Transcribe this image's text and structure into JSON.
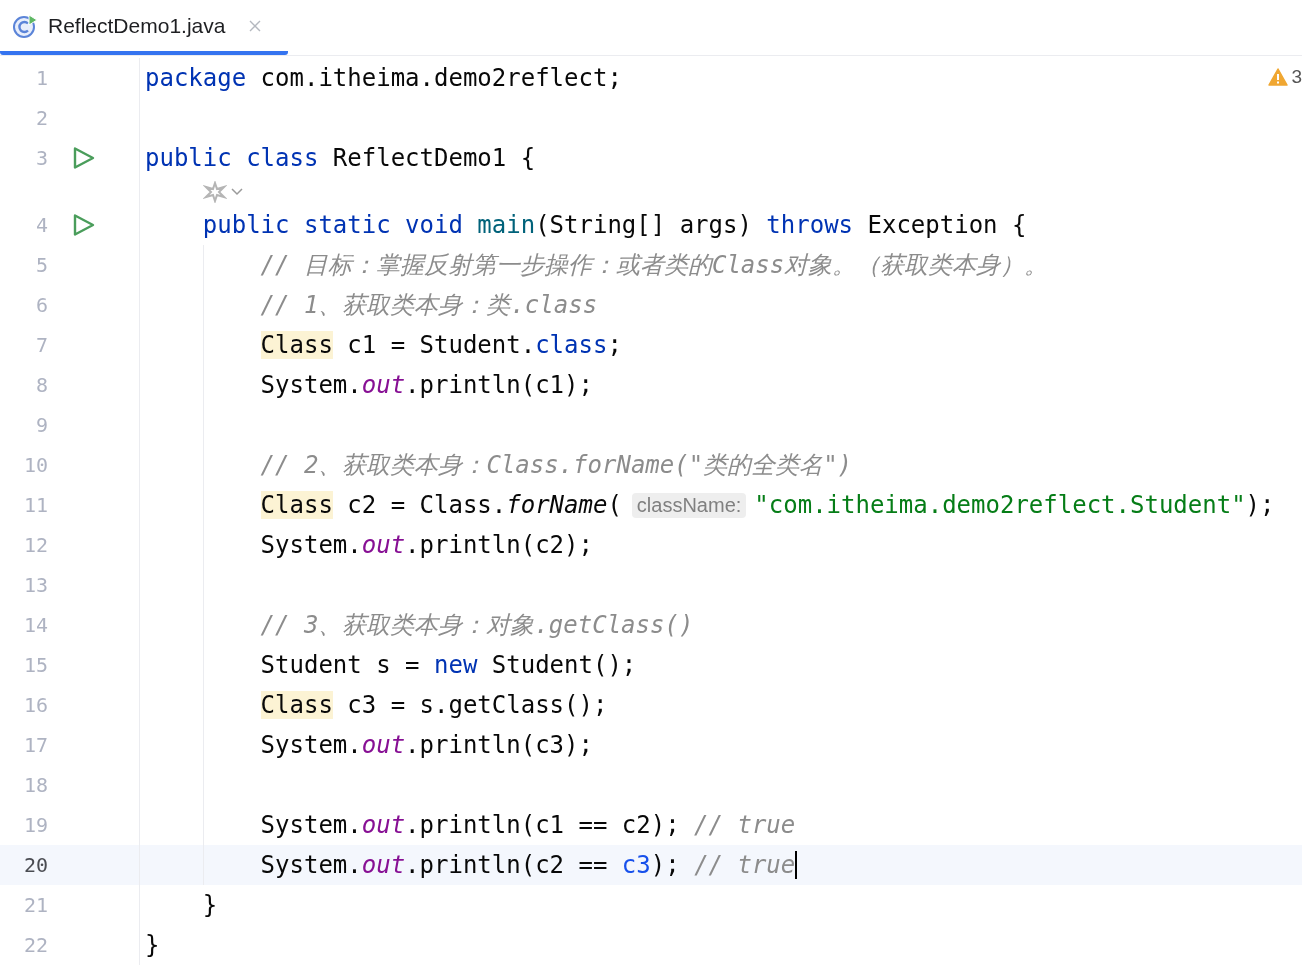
{
  "tabs": [
    {
      "label": "ReflectDemo1.java",
      "selected": true
    }
  ],
  "inspections": {
    "warnings": "3"
  },
  "lines": [
    {
      "kind": "code",
      "number": "1",
      "run": false,
      "current": false,
      "tokens": [
        {
          "kind": "keyword",
          "text": "package"
        },
        {
          "kind": "plain",
          "text": " com.itheima.demo2reflect;"
        }
      ]
    },
    {
      "kind": "code",
      "number": "2",
      "run": false,
      "current": false
    },
    {
      "kind": "code",
      "number": "3",
      "run": true,
      "current": false,
      "tokens": [
        {
          "kind": "keyword",
          "text": "public"
        },
        {
          "kind": "keyword",
          "text": " class"
        },
        {
          "kind": "plain",
          "text": " ReflectDemo1 {"
        }
      ],
      "children": [
        {
          "kind": "inlay"
        },
        {
          "kind": "code",
          "number": "4",
          "run": true,
          "current": false,
          "tokens": [
            {
              "kind": "keyword",
              "text": "public"
            },
            {
              "kind": "keyword",
              "text": " static"
            },
            {
              "kind": "keyword",
              "text": " void"
            },
            {
              "kind": "decl",
              "text": " main"
            },
            {
              "kind": "plain",
              "text": "(String[] args) "
            },
            {
              "kind": "keyword",
              "text": "throws"
            },
            {
              "kind": "plain",
              "text": " Exception {"
            }
          ],
          "children": [
            {
              "kind": "code",
              "number": "5",
              "run": false,
              "current": false,
              "tokens": [
                {
                  "kind": "comment",
                  "text": "// 目标：掌握反射第一步操作：或者类的Class对象。（获取类本身）。"
                }
              ]
            },
            {
              "kind": "code",
              "number": "6",
              "run": false,
              "current": false,
              "tokens": [
                {
                  "kind": "comment",
                  "text": "// 1、获取类本身：类.class"
                }
              ]
            },
            {
              "kind": "code",
              "number": "7",
              "run": false,
              "current": false,
              "tokens": [
                {
                  "kind": "type",
                  "text": "Class"
                },
                {
                  "kind": "plain",
                  "text": " c1 = Student."
                },
                {
                  "kind": "keyword",
                  "text": "class"
                },
                {
                  "kind": "plain",
                  "text": ";"
                }
              ]
            },
            {
              "kind": "code",
              "number": "8",
              "run": false,
              "current": false,
              "tokens": [
                {
                  "kind": "plain",
                  "text": "System."
                },
                {
                  "kind": "static",
                  "text": "out"
                },
                {
                  "kind": "plain",
                  "text": ".println(c1);"
                }
              ]
            },
            {
              "kind": "code",
              "number": "9",
              "run": false,
              "current": false
            },
            {
              "kind": "code",
              "number": "10",
              "run": false,
              "current": false,
              "tokens": [
                {
                  "kind": "comment",
                  "text": "// 2、获取类本身：Class.forName(\"类的全类名\")"
                }
              ]
            },
            {
              "kind": "code",
              "number": "11",
              "run": false,
              "current": false,
              "tokens": [
                {
                  "kind": "type",
                  "text": "Class"
                },
                {
                  "kind": "plain",
                  "text": " c2 = Class."
                },
                {
                  "kind": "method",
                  "text": "forName"
                },
                {
                  "kind": "plain",
                  "text": "("
                },
                {
                  "kind": "hint",
                  "text": "className:"
                },
                {
                  "kind": "string",
                  "text": "\"com.itheima.demo2reflect.Student\""
                },
                {
                  "kind": "plain",
                  "text": ");"
                }
              ]
            },
            {
              "kind": "code",
              "number": "12",
              "run": false,
              "current": false,
              "tokens": [
                {
                  "kind": "plain",
                  "text": "System."
                },
                {
                  "kind": "static",
                  "text": "out"
                },
                {
                  "kind": "plain",
                  "text": ".println(c2);"
                }
              ]
            },
            {
              "kind": "code",
              "number": "13",
              "run": false,
              "current": false
            },
            {
              "kind": "code",
              "number": "14",
              "run": false,
              "current": false,
              "tokens": [
                {
                  "kind": "comment",
                  "text": "// 3、获取类本身：对象.getClass()"
                }
              ]
            },
            {
              "kind": "code",
              "number": "15",
              "run": false,
              "current": false,
              "tokens": [
                {
                  "kind": "plain",
                  "text": "Student s = "
                },
                {
                  "kind": "keyword",
                  "text": "new"
                },
                {
                  "kind": "plain",
                  "text": " Student();"
                }
              ]
            },
            {
              "kind": "code",
              "number": "16",
              "run": false,
              "current": false,
              "tokens": [
                {
                  "kind": "type",
                  "text": "Class"
                },
                {
                  "kind": "plain",
                  "text": " c3 = s.getClass();"
                }
              ]
            },
            {
              "kind": "code",
              "number": "17",
              "run": false,
              "current": false,
              "tokens": [
                {
                  "kind": "plain",
                  "text": "System."
                },
                {
                  "kind": "static",
                  "text": "out"
                },
                {
                  "kind": "plain",
                  "text": ".println(c3);"
                }
              ]
            },
            {
              "kind": "code",
              "number": "18",
              "run": false,
              "current": false
            },
            {
              "kind": "code",
              "number": "19",
              "run": false,
              "current": false,
              "tokens": [
                {
                  "kind": "plain",
                  "text": "System."
                },
                {
                  "kind": "static",
                  "text": "out"
                },
                {
                  "kind": "plain",
                  "text": ".println(c1 == c2); "
                },
                {
                  "kind": "comment",
                  "text": "// true"
                }
              ]
            },
            {
              "kind": "code",
              "number": "20",
              "run": false,
              "current": true,
              "tokens": [
                {
                  "kind": "plain",
                  "text": "System."
                },
                {
                  "kind": "static",
                  "text": "out"
                },
                {
                  "kind": "plain",
                  "text": ".println(c2 == "
                },
                {
                  "kind": "ref",
                  "text": "c3"
                },
                {
                  "kind": "plain",
                  "text": "); "
                },
                {
                  "kind": "comment",
                  "text": "// true"
                }
              ]
            }
          ]
        },
        {
          "kind": "code",
          "number": "21",
          "run": false,
          "current": false,
          "tokens": [
            {
              "kind": "plain",
              "text": "}"
            }
          ]
        }
      ]
    },
    {
      "kind": "code",
      "number": "22",
      "run": false,
      "current": false,
      "tokens": [
        {
          "kind": "plain",
          "text": "}"
        }
      ]
    }
  ]
}
